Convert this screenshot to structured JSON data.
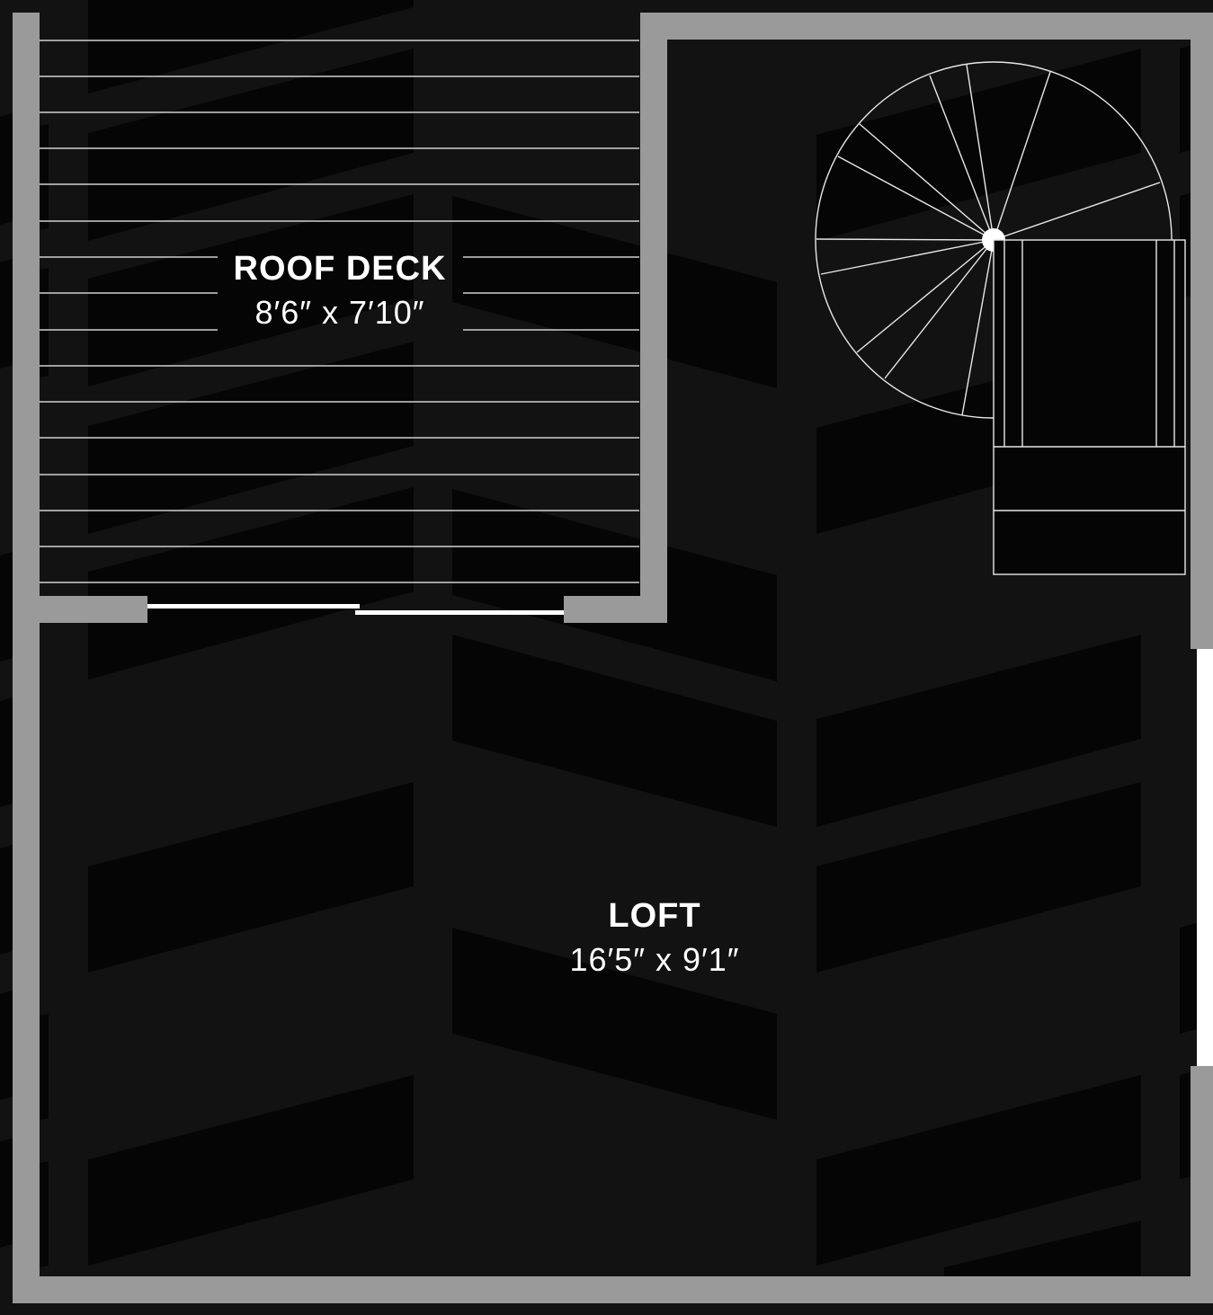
{
  "floorplan": {
    "rooms": [
      {
        "name": "ROOF DECK",
        "dimensions": "8′6″ x 7′10″"
      },
      {
        "name": "LOFT",
        "dimensions": "16′5″ x 9′1″"
      }
    ]
  },
  "colors": {
    "background": "#121212",
    "pattern": "#050505",
    "wall": "#9a9a9a",
    "line": "#ffffff",
    "text": "#ffffff"
  }
}
